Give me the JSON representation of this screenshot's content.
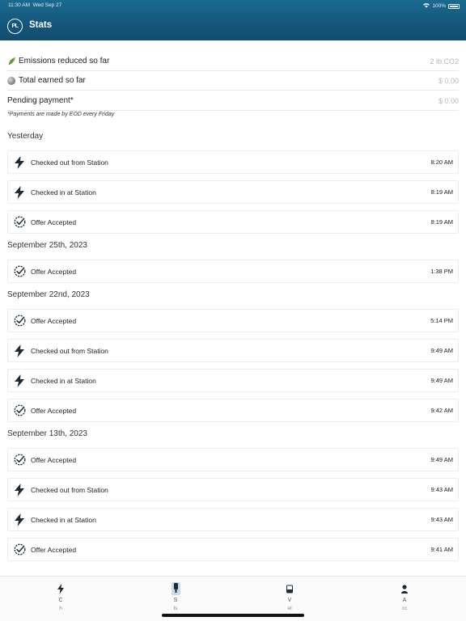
{
  "status_bar": {
    "time": "11:30 AM",
    "date": "Wed Sep 27",
    "battery": "100%"
  },
  "header": {
    "logo_text": "PL",
    "title": "Stats",
    "colors": {
      "background": "#15567a",
      "text": "#ffffff"
    }
  },
  "summary": {
    "emissions_label": "Emissions reduced so far",
    "emissions_value": "2 lb.CO2",
    "earned_label": "Total earned so far",
    "earned_value": "$ 0.00",
    "pending_label": "Pending payment*",
    "pending_value": "$ 0.00",
    "note": "*Payments are made by EOD every Friday"
  },
  "sections": [
    {
      "title": "Yesterday",
      "items": [
        {
          "icon": "bolt-icon",
          "label": "Checked out from Station",
          "time": "8:20 AM"
        },
        {
          "icon": "bolt-icon",
          "label": "Checked in at Station",
          "time": "8:19 AM"
        },
        {
          "icon": "offer-check-icon",
          "label": "Offer Accepted",
          "time": "8:19 AM"
        }
      ]
    },
    {
      "title": "September 25th, 2023",
      "items": [
        {
          "icon": "offer-check-icon",
          "label": "Offer Accepted",
          "time": "1:38 PM"
        }
      ]
    },
    {
      "title": "September 22nd, 2023",
      "items": [
        {
          "icon": "offer-check-icon",
          "label": "Offer Accepted",
          "time": "5:14 PM"
        },
        {
          "icon": "bolt-icon",
          "label": "Checked out from Station",
          "time": "9:49 AM"
        },
        {
          "icon": "bolt-icon",
          "label": "Checked in at Station",
          "time": "9:49 AM"
        },
        {
          "icon": "offer-check-icon",
          "label": "Offer Accepted",
          "time": "9:42 AM"
        }
      ]
    },
    {
      "title": "September 13th, 2023",
      "items": [
        {
          "icon": "offer-check-icon",
          "label": "Offer Accepted",
          "time": "9:49 AM"
        },
        {
          "icon": "bolt-icon",
          "label": "Checked out from Station",
          "time": "9:43 AM"
        },
        {
          "icon": "bolt-icon",
          "label": "Checked in at Station",
          "time": "9:43 AM"
        },
        {
          "icon": "offer-check-icon",
          "label": "Offer Accepted",
          "time": "9:41 AM"
        }
      ]
    }
  ],
  "tabbar": {
    "tabs": [
      {
        "icon": "bolt-icon",
        "label": "C",
        "sub": "h",
        "active": false
      },
      {
        "icon": "stats-icon",
        "label": "S",
        "sub": "ts",
        "active": true
      },
      {
        "icon": "vehicle-icon",
        "label": "V",
        "sub": "el",
        "active": false
      },
      {
        "icon": "account-icon",
        "label": "A",
        "sub": "cc",
        "active": false
      }
    ],
    "active_color": "#c9dbe6"
  }
}
